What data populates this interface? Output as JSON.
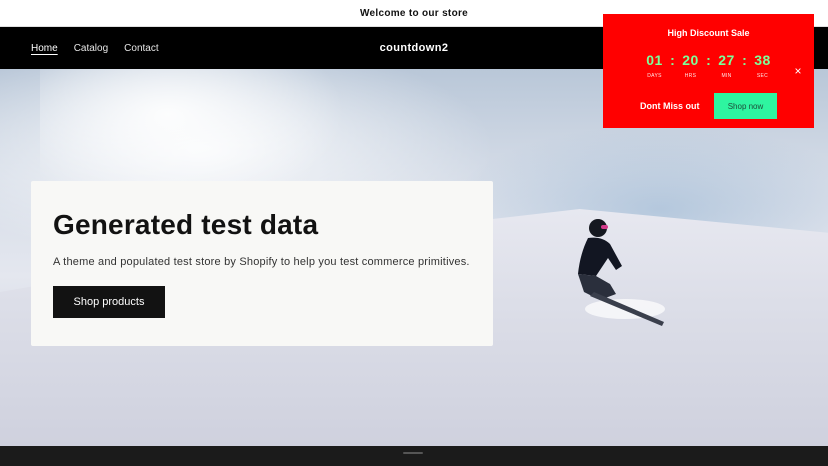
{
  "announcement": {
    "text": "Welcome to our store"
  },
  "header": {
    "store_name": "countdown2",
    "nav": [
      {
        "label": "Home",
        "active": true
      },
      {
        "label": "Catalog",
        "active": false
      },
      {
        "label": "Contact",
        "active": false
      }
    ]
  },
  "hero": {
    "title": "Generated test data",
    "subtitle": "A theme and populated test store by Shopify to help you test commerce primitives.",
    "button_label": "Shop products"
  },
  "popup": {
    "title": "High Discount Sale",
    "countdown": [
      {
        "value": "01",
        "label": "DAYS"
      },
      {
        "value": "20",
        "label": "HRS"
      },
      {
        "value": "27",
        "label": "MIN"
      },
      {
        "value": "38",
        "label": "SEC"
      }
    ],
    "separator": ":",
    "close_glyph": "×",
    "message": "Dont Miss out",
    "button_label": "Shop now",
    "colors": {
      "background": "#ff0000",
      "digits": "#7dff9a",
      "button": "#2ef5a0"
    }
  },
  "icons": {
    "close": "close-icon"
  }
}
